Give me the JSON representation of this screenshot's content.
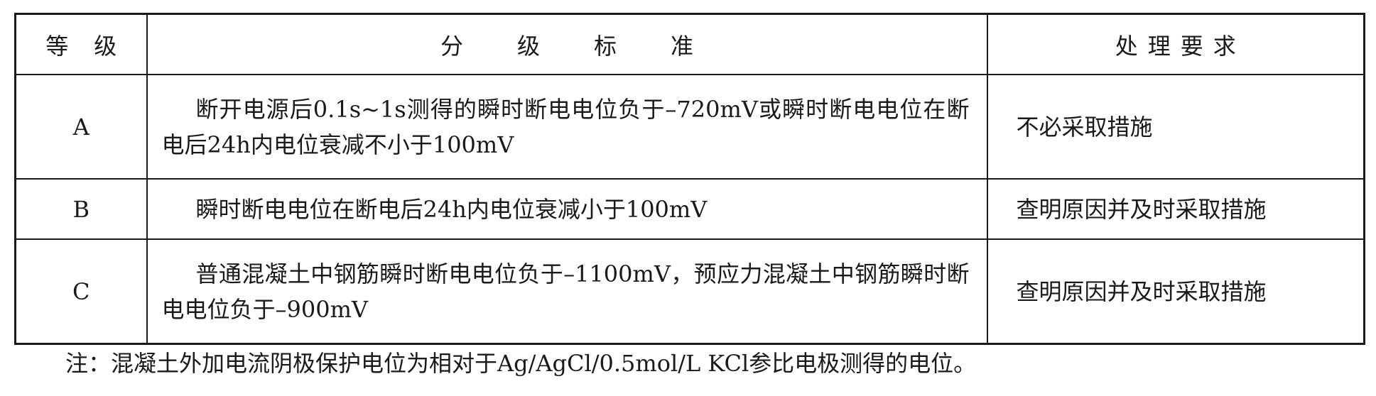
{
  "table": {
    "headers": {
      "grade": "等级",
      "criteria": "分级标准",
      "action": "处理要求"
    },
    "rows": [
      {
        "grade": "A",
        "criteria": "断开电源后0.1s~1s测得的瞬时断电电位负于–720mV或瞬时断电电位在断电后24h内电位衰减不小于100mV",
        "action": "不必采取措施"
      },
      {
        "grade": "B",
        "criteria": "瞬时断电电位在断电后24h内电位衰减小于100mV",
        "action": "查明原因并及时采取措施"
      },
      {
        "grade": "C",
        "criteria": "普通混凝土中钢筋瞬时断电电位负于–1100mV，预应力混凝土中钢筋瞬时断电电位负于–900mV",
        "action": "查明原因并及时采取措施"
      }
    ]
  },
  "note": "注：混凝土外加电流阴极保护电位为相对于Ag/AgCl/0.5mol/L KCl参比电极测得的电位。"
}
